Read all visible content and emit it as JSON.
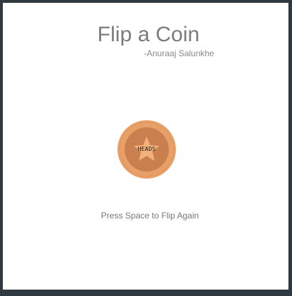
{
  "app": {
    "title": "Flip a Coin",
    "author": "-Anuraaj Salunkhe"
  },
  "coin": {
    "face_label": "HEADS",
    "icon": "star-icon",
    "colors": {
      "outer": "#e9a066",
      "inner": "#c97f4e",
      "star": "#f2b27a"
    }
  },
  "instructions": {
    "text": "Press Space to Flip Again"
  }
}
